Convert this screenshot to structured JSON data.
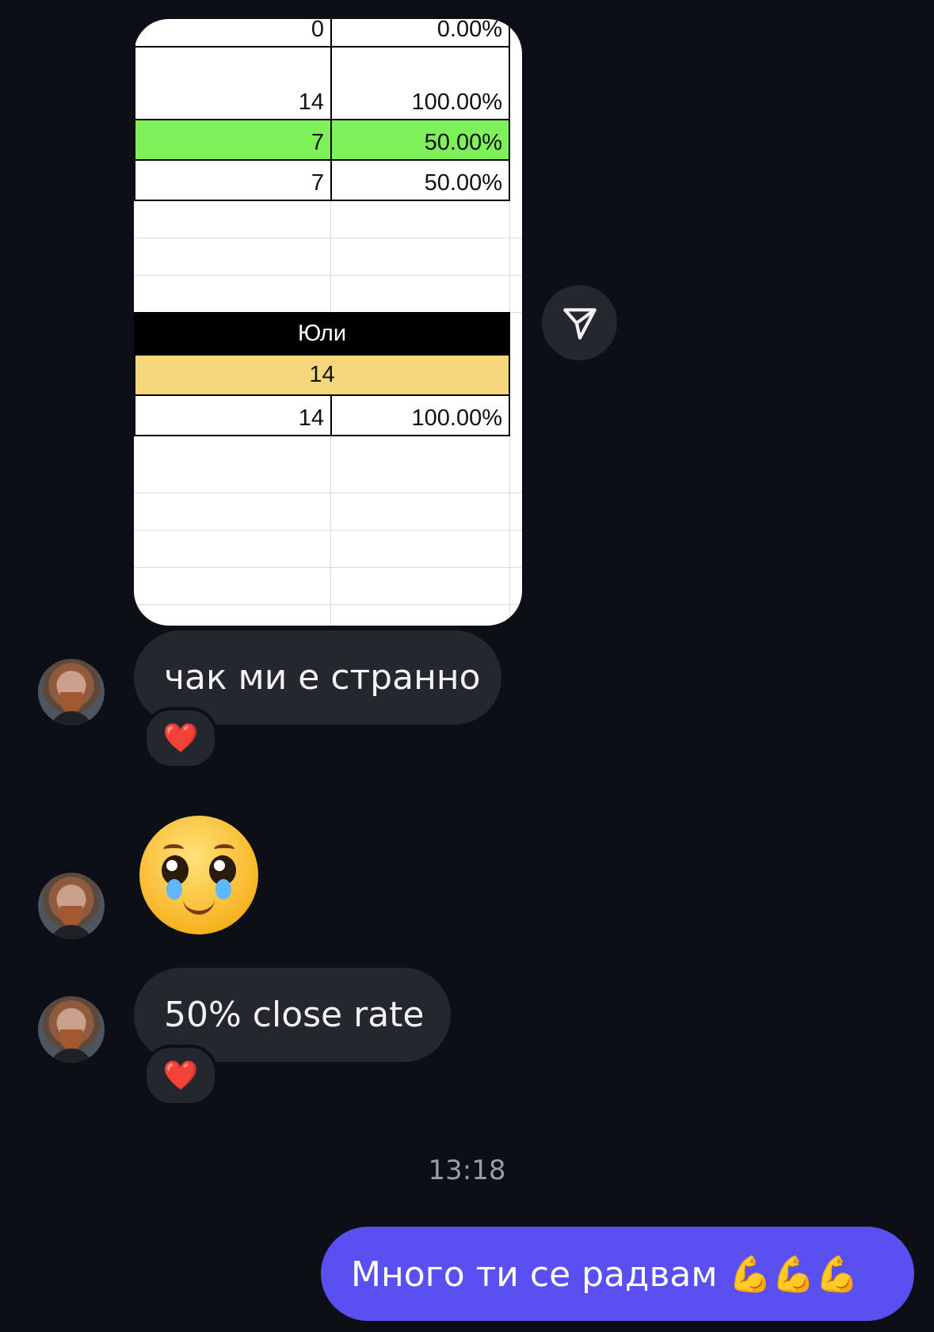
{
  "spreadsheet": {
    "rows": [
      {
        "count": "0",
        "percent": "0.00%"
      },
      {
        "count": "14",
        "percent": "100.00%"
      },
      {
        "count": "7",
        "percent": "50.00%",
        "highlight": "#7ef05a"
      },
      {
        "count": "7",
        "percent": "50.00%"
      }
    ],
    "section_header": "Юли",
    "section_total": "14",
    "section_total_color": "#f7d77c",
    "section_row": {
      "count": "14",
      "percent": "100.00%"
    }
  },
  "messages": {
    "msg1": {
      "text": "чак ми е странно",
      "reaction": "❤️"
    },
    "msg2": {
      "emoji": "pleading-face-with-tears"
    },
    "msg3": {
      "text": "50% close rate",
      "reaction": "❤️"
    },
    "timestamp": "13:18",
    "outgoing": {
      "text": "Много ти се радвам 💪💪💪"
    }
  },
  "colors": {
    "background": "#0d0f16",
    "incoming_bubble": "#25272f",
    "outgoing_bubble": "#5a4ff0",
    "timestamp_text": "#9b9ca6"
  },
  "icons": {
    "share": "share-send-icon",
    "avatar": "contact-avatar"
  }
}
